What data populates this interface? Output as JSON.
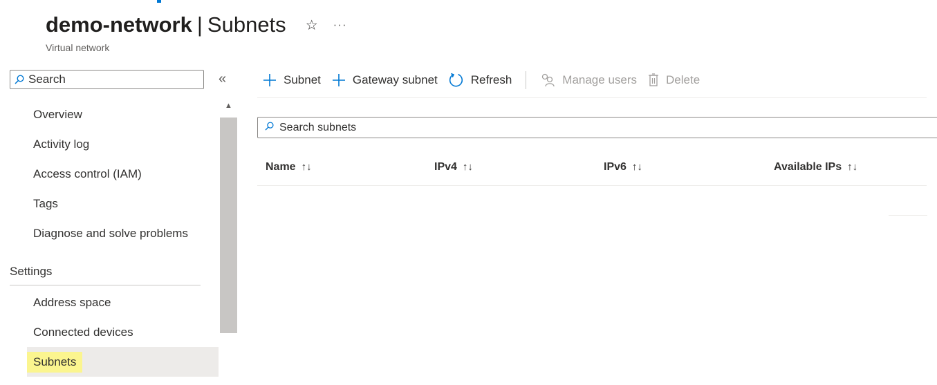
{
  "header": {
    "resource_name": "demo-network",
    "separator": "|",
    "page_name": "Subnets",
    "subtitle": "Virtual network",
    "favorite_icon": "star-icon",
    "more_label": "···"
  },
  "sidebar": {
    "search_placeholder": "Search",
    "collapse_label": "«",
    "items": [
      {
        "label": "Overview"
      },
      {
        "label": "Activity log"
      },
      {
        "label": "Access control (IAM)"
      },
      {
        "label": "Tags"
      },
      {
        "label": "Diagnose and solve problems"
      }
    ],
    "section_settings": "Settings",
    "settings_items": [
      {
        "label": "Address space"
      },
      {
        "label": "Connected devices"
      },
      {
        "label": "Subnets",
        "selected": true
      }
    ]
  },
  "toolbar": {
    "add_subnet": "Subnet",
    "add_gateway_subnet": "Gateway subnet",
    "refresh": "Refresh",
    "manage_users": "Manage users",
    "delete": "Delete"
  },
  "grid": {
    "search_placeholder": "Search subnets",
    "columns": [
      {
        "label": "Name",
        "sort": "↑↓"
      },
      {
        "label": "IPv4",
        "sort": "↑↓"
      },
      {
        "label": "IPv6",
        "sort": "↑↓"
      },
      {
        "label": "Available IPs",
        "sort": "↑↓"
      }
    ],
    "rows": []
  },
  "colors": {
    "accent": "#0078d4",
    "selected_bg": "#edebe9",
    "highlight": "#fbf58f",
    "disabled_text": "#a19f9d"
  }
}
